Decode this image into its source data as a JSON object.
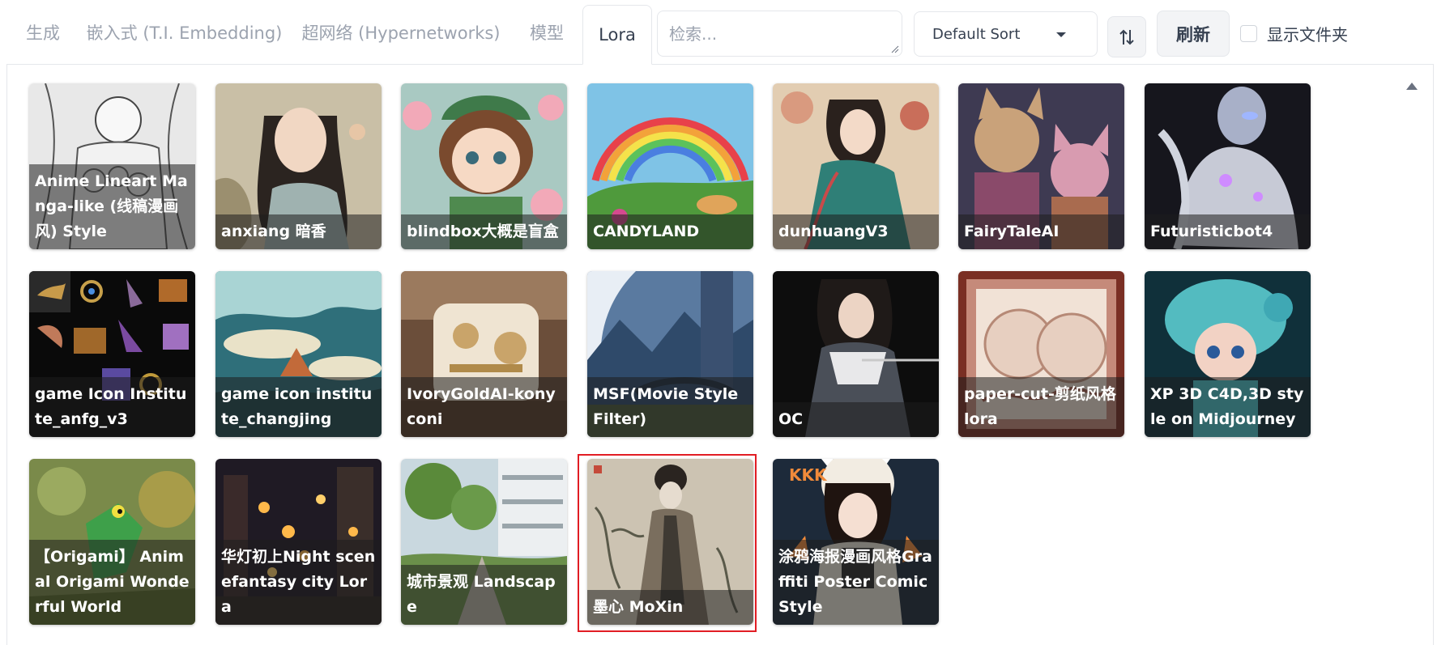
{
  "tabs": [
    {
      "label": "生成"
    },
    {
      "label": "嵌入式 (T.I. Embedding)"
    },
    {
      "label": "超网络 (Hypernetworks)"
    },
    {
      "label": "模型"
    },
    {
      "label": "Lora"
    }
  ],
  "search": {
    "placeholder": "检索..."
  },
  "sort": {
    "selected": "Default Sort"
  },
  "refresh_label": "刷新",
  "show_dirs_label": "显示文件夹",
  "cards": [
    {
      "name": "Anime Lineart Manga-like (线稿漫画风) Style"
    },
    {
      "name": "anxiang 暗香"
    },
    {
      "name": "blindbox大概是盲盒"
    },
    {
      "name": "CANDYLAND"
    },
    {
      "name": "dunhuangV3"
    },
    {
      "name": "FairyTaleAI"
    },
    {
      "name": "Futuristicbot4"
    },
    {
      "name": "game Icon Institute_anfg_v3"
    },
    {
      "name": "game icon institute_changjing"
    },
    {
      "name": "IvoryGoldAI-konyconi"
    },
    {
      "name": "MSF(Movie Style Filter)"
    },
    {
      "name": "OC"
    },
    {
      "name": "paper-cut-剪纸风格lora"
    },
    {
      "name": "XP 3D C4D,3D style on Midjourney"
    },
    {
      "name": "【Origami】 Animal Origami Wonderful World"
    },
    {
      "name": "华灯初上Night scenefantasy city Lora"
    },
    {
      "name": "城市景观 Landscape"
    },
    {
      "name": "墨心 MoXin",
      "selected": true
    },
    {
      "name": "涂鸦海报漫画风格Graffiti Poster Comic Style",
      "thumb_text": "KKK"
    }
  ],
  "colors": {
    "selected_border": "#e11d24",
    "tab_inactive": "#9ca3af"
  }
}
